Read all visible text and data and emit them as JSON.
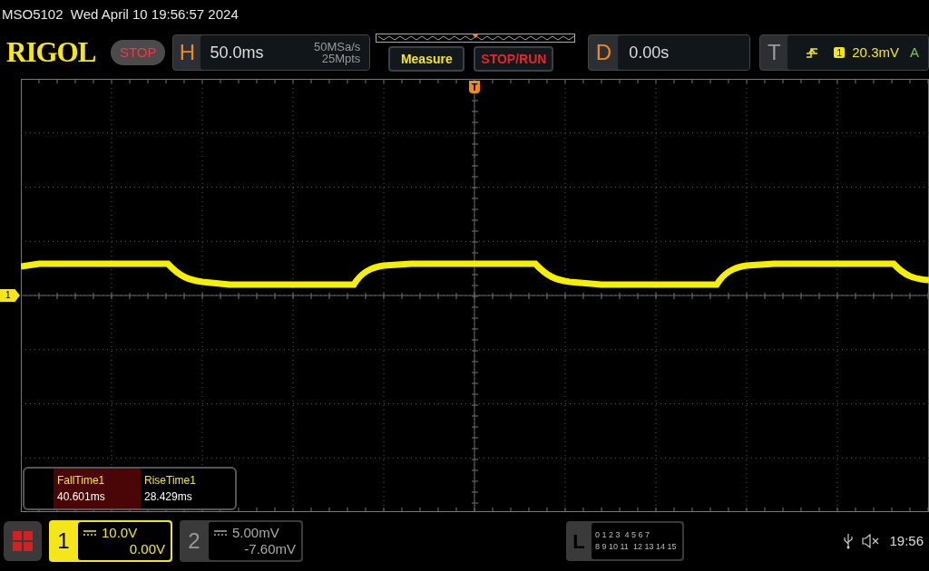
{
  "status_line": "MSO5102  Wed April 10 19:56:57 2024",
  "header": {
    "logo": "RIGOL",
    "run_state": "STOP",
    "horizontal": {
      "label": "H",
      "timebase": "50.0ms",
      "sample_rate": "50MSa/s",
      "memory_depth": "25Mpts"
    },
    "buttons": [
      {
        "label": "Measure",
        "kind": "menu"
      },
      {
        "label": "STOP/RUN",
        "kind": "run"
      }
    ],
    "delay": {
      "label": "D",
      "value": "0.00s"
    },
    "trigger": {
      "label": "T",
      "source": "1",
      "trigger_level": "20.3mV",
      "mode": "A"
    }
  },
  "trigger_marker": "T",
  "channel_marker": "1",
  "measurements": [
    {
      "name": "FallTime1",
      "value": "40.601ms",
      "selected": true
    },
    {
      "name": "RiseTime1",
      "value": "28.429ms",
      "selected": false
    }
  ],
  "channels": [
    {
      "number": "1",
      "scale": "10.0V",
      "offset": "0.00V",
      "active": true
    },
    {
      "number": "2",
      "scale": "5.00mV",
      "offset": "-7.60mV",
      "active": false
    }
  ],
  "logic": {
    "label": "L",
    "rows": [
      [
        "0 1 2 3",
        "4 5 6 7"
      ],
      [
        "8 9 10 11",
        "12 13 14 15"
      ]
    ]
  },
  "clock": "19:56"
}
